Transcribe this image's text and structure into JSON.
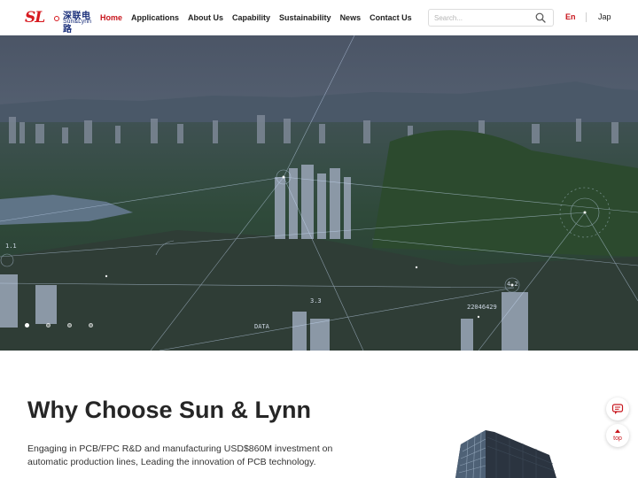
{
  "header": {
    "logo": {
      "mark": "SL",
      "cn": "深联电路",
      "en": "Sun&Lynn"
    },
    "nav": [
      {
        "label": "Home",
        "active": true
      },
      {
        "label": "Applications"
      },
      {
        "label": "About Us"
      },
      {
        "label": "Capability"
      },
      {
        "label": "Sustainability"
      },
      {
        "label": "News"
      },
      {
        "label": "Contact Us"
      }
    ],
    "search": {
      "placeholder": "Search..."
    },
    "lang": {
      "current": "En",
      "other": "Jap"
    }
  },
  "hero": {
    "slides_count": 4,
    "active_slide": 1,
    "labels": [
      "22046429",
      "DATA",
      "4.2",
      "1.1",
      "3.3"
    ]
  },
  "why": {
    "title": "Why Choose Sun & Lynn",
    "text": "Engaging in PCB/FPC R&D and manufacturing USD$860M investment on automatic production lines, Leading the innovation of PCB technology."
  },
  "side": {
    "top_label": "top"
  },
  "colors": {
    "brand_red": "#c8161d",
    "logo_blue": "#1a2f7a",
    "heading": "#262626"
  }
}
